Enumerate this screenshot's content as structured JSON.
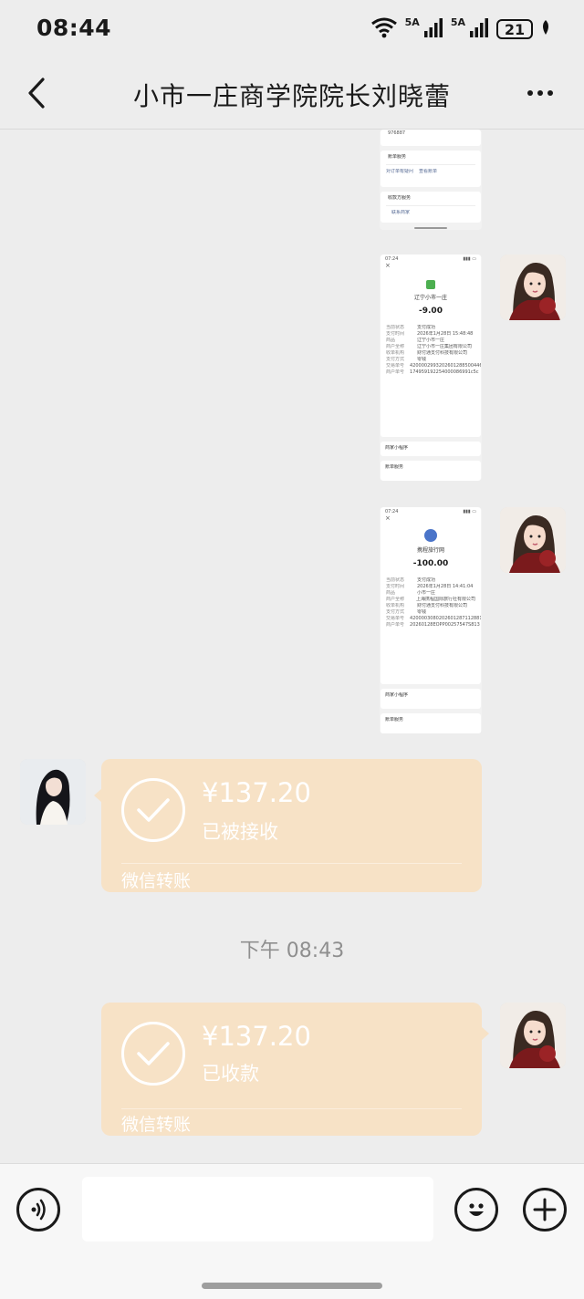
{
  "status_bar": {
    "time": "08:44",
    "signal1_label": "5A",
    "signal2_label": "5A",
    "battery": "21"
  },
  "header": {
    "title": "小市一庄商学院院长刘晓蕾"
  },
  "messages": {
    "image1": {
      "text_top": "976887",
      "section_service": "账单服务",
      "btn_a": "对订单有疑问",
      "btn_b": "查看账单",
      "section_merchant": "收款方服务",
      "btn_c": "联系商家"
    },
    "image2": {
      "time": "07:24",
      "merchant": "辽宁小市一庄",
      "amount": "-9.00",
      "rows": [
        [
          "当前状态",
          "支付成功"
        ],
        [
          "支付时间",
          "2026年1月28日 15:48:48"
        ],
        [
          "商品",
          "辽宁小市一庄"
        ],
        [
          "商户全称",
          "辽宁小市一庄集团有限公司"
        ],
        [
          "收单机构",
          "财付通支付科技有限公司"
        ],
        [
          "支付方式",
          "零钱"
        ],
        [
          "交易单号",
          "4200002993202601288500446556"
        ],
        [
          "商户单号",
          "174959192254000086991c5c"
        ]
      ],
      "section_a": "商家小程序",
      "section_b": "账单服务"
    },
    "image3": {
      "time": "07:24",
      "merchant": "携程旅行网",
      "amount": "-100.00",
      "rows": [
        [
          "当前状态",
          "支付成功"
        ],
        [
          "支付时间",
          "2026年1月28日 14:41:04"
        ],
        [
          "商品",
          "小市一庄"
        ],
        [
          "商户全称",
          "上海携程国际旅行社有限公司"
        ],
        [
          "收单机构",
          "财付通支付科技有限公司"
        ],
        [
          "支付方式",
          "零钱"
        ],
        [
          "交易单号",
          "4200003080202601287112881438"
        ],
        [
          "商户单号",
          "20260128EOPP00257547S813"
        ]
      ],
      "section_a": "商家小程序",
      "section_b": "账单服务"
    },
    "transfer_received": {
      "amount": "¥137.20",
      "status": "已被接收",
      "footer": "微信转账"
    },
    "timestamp": "下午 08:43",
    "transfer_collected": {
      "amount": "¥137.20",
      "status": "已收款",
      "footer": "微信转账"
    }
  },
  "input_bar": {
    "placeholder": ""
  },
  "colors": {
    "background": "#ededed",
    "transfer_bubble": "#f7e2c6",
    "timestamp": "#8f8f8f"
  }
}
